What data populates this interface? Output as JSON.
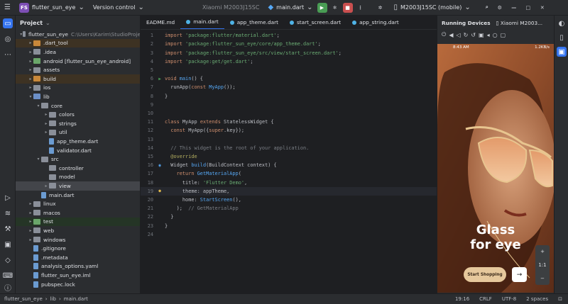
{
  "titlebar": {
    "project_chip": "FS",
    "project_name": "flutter_sun_eye",
    "vcs": "Version control",
    "device_selector": "Xiaomi M2003J15SC",
    "run_config": "main.dart",
    "device_menu": "M2003J15SC (mobile)"
  },
  "project_panel": {
    "title": "Project",
    "tree": [
      {
        "label": "flutter_sun_eye",
        "extra": "C:\\Users\\Karim\\StudioProje",
        "indent": 0,
        "arrow": "▾",
        "icon": "folder",
        "hl": ""
      },
      {
        "label": ".dart_tool",
        "extra": "",
        "indent": 1,
        "arrow": "▸",
        "icon": "folder orange",
        "hl": "hl-orange"
      },
      {
        "label": ".idea",
        "extra": "",
        "indent": 1,
        "arrow": "▸",
        "icon": "folder",
        "hl": ""
      },
      {
        "label": "android [flutter_sun_eye_android]",
        "extra": "",
        "indent": 1,
        "arrow": "▸",
        "icon": "folder green",
        "hl": ""
      },
      {
        "label": "assets",
        "extra": "",
        "indent": 1,
        "arrow": "▸",
        "icon": "folder",
        "hl": ""
      },
      {
        "label": "build",
        "extra": "",
        "indent": 1,
        "arrow": "▸",
        "icon": "folder orange",
        "hl": "hl-orange"
      },
      {
        "label": "ios",
        "extra": "",
        "indent": 1,
        "arrow": "▸",
        "icon": "folder",
        "hl": ""
      },
      {
        "label": "lib",
        "extra": "",
        "indent": 1,
        "arrow": "▾",
        "icon": "folder blue",
        "hl": ""
      },
      {
        "label": "core",
        "extra": "",
        "indent": 2,
        "arrow": "▾",
        "icon": "folder",
        "hl": ""
      },
      {
        "label": "colors",
        "extra": "",
        "indent": 3,
        "arrow": "▸",
        "icon": "folder",
        "hl": ""
      },
      {
        "label": "strings",
        "extra": "",
        "indent": 3,
        "arrow": "▸",
        "icon": "folder",
        "hl": ""
      },
      {
        "label": "util",
        "extra": "",
        "indent": 3,
        "arrow": "▸",
        "icon": "folder",
        "hl": ""
      },
      {
        "label": "app_theme.dart",
        "extra": "",
        "indent": 3,
        "arrow": "",
        "icon": "file",
        "hl": ""
      },
      {
        "label": "validator.dart",
        "extra": "",
        "indent": 3,
        "arrow": "",
        "icon": "file",
        "hl": ""
      },
      {
        "label": "src",
        "extra": "",
        "indent": 2,
        "arrow": "▾",
        "icon": "folder",
        "hl": ""
      },
      {
        "label": "controller",
        "extra": "",
        "indent": 3,
        "arrow": "",
        "icon": "folder",
        "hl": ""
      },
      {
        "label": "model",
        "extra": "",
        "indent": 3,
        "arrow": "",
        "icon": "folder",
        "hl": ""
      },
      {
        "label": "view",
        "extra": "",
        "indent": 3,
        "arrow": "▸",
        "icon": "folder",
        "hl": "selected"
      },
      {
        "label": "main.dart",
        "extra": "",
        "indent": 2,
        "arrow": "",
        "icon": "file",
        "hl": ""
      },
      {
        "label": "linux",
        "extra": "",
        "indent": 1,
        "arrow": "▸",
        "icon": "folder",
        "hl": ""
      },
      {
        "label": "macos",
        "extra": "",
        "indent": 1,
        "arrow": "▸",
        "icon": "folder",
        "hl": ""
      },
      {
        "label": "test",
        "extra": "",
        "indent": 1,
        "arrow": "▸",
        "icon": "folder green",
        "hl": "hl-green"
      },
      {
        "label": "web",
        "extra": "",
        "indent": 1,
        "arrow": "▸",
        "icon": "folder",
        "hl": ""
      },
      {
        "label": "windows",
        "extra": "",
        "indent": 1,
        "arrow": "▸",
        "icon": "folder",
        "hl": ""
      },
      {
        "label": ".gitignore",
        "extra": "",
        "indent": 1,
        "arrow": "",
        "icon": "file",
        "hl": ""
      },
      {
        "label": ".metadata",
        "extra": "",
        "indent": 1,
        "arrow": "",
        "icon": "file",
        "hl": ""
      },
      {
        "label": "analysis_options.yaml",
        "extra": "",
        "indent": 1,
        "arrow": "",
        "icon": "file",
        "hl": ""
      },
      {
        "label": "flutter_sun_eye.iml",
        "extra": "",
        "indent": 1,
        "arrow": "",
        "icon": "file",
        "hl": ""
      },
      {
        "label": "pubspec.lock",
        "extra": "",
        "indent": 1,
        "arrow": "",
        "icon": "file",
        "hl": ""
      }
    ]
  },
  "editor": {
    "tabs": [
      "EADME.md",
      "main.dart",
      "app_theme.dart",
      "start_screen.dart",
      "app_string.dart"
    ],
    "active_tab": 1,
    "current_line": 19,
    "lines": [
      [
        [
          "kw",
          "import "
        ],
        [
          "str",
          "'package:flutter/material.dart'"
        ],
        [
          "ctext",
          ";"
        ]
      ],
      [
        [
          "kw",
          "import "
        ],
        [
          "str",
          "'package:flutter_sun_eye/core/app_theme.dart'"
        ],
        [
          "ctext",
          ";"
        ]
      ],
      [
        [
          "kw",
          "import "
        ],
        [
          "str",
          "'package:flutter_sun_eye/src/view/start_screen.dart'"
        ],
        [
          "ctext",
          ";"
        ]
      ],
      [
        [
          "kw",
          "import "
        ],
        [
          "str",
          "'package:get/get.dart'"
        ],
        [
          "ctext",
          ";"
        ]
      ],
      [],
      [
        [
          "kw",
          "void "
        ],
        [
          "fn",
          "main"
        ],
        [
          "ctext",
          "() {"
        ]
      ],
      [
        [
          "ctext",
          "  runApp("
        ],
        [
          "kw",
          "const "
        ],
        [
          "cls",
          "MyApp"
        ],
        [
          "ctext",
          "());"
        ]
      ],
      [
        [
          "ctext",
          "}"
        ]
      ],
      [],
      [],
      [
        [
          "kw",
          "class "
        ],
        [
          "ctext",
          "MyApp "
        ],
        [
          "kw",
          "extends "
        ],
        [
          "ctext",
          "StatelessWidget {"
        ]
      ],
      [
        [
          "ctext",
          "  "
        ],
        [
          "kw",
          "const "
        ],
        [
          "ctext",
          "MyApp({"
        ],
        [
          "kw",
          "super"
        ],
        [
          "ctext",
          ".key});"
        ]
      ],
      [],
      [
        [
          "cmt",
          "  // This widget is the root of your application."
        ]
      ],
      [
        [
          "ann",
          "  @override"
        ]
      ],
      [
        [
          "ctext",
          "  Widget "
        ],
        [
          "fn",
          "build"
        ],
        [
          "ctext",
          "(BuildContext context) {"
        ]
      ],
      [
        [
          "kw",
          "    return "
        ],
        [
          "cls",
          "GetMaterialApp"
        ],
        [
          "ctext",
          "("
        ]
      ],
      [
        [
          "ctext",
          "      title: "
        ],
        [
          "str",
          "'Flutter Demo'"
        ],
        [
          "ctext",
          ","
        ]
      ],
      [
        [
          "ctext",
          "      theme: appTheme,"
        ]
      ],
      [
        [
          "ctext",
          "      home: "
        ],
        [
          "cls",
          "StartScreen"
        ],
        [
          "ctext",
          "(),"
        ]
      ],
      [
        [
          "ctext",
          "    ); "
        ],
        [
          "cmt",
          " // GetMaterialApp"
        ]
      ],
      [
        [
          "ctext",
          "  }"
        ]
      ],
      [
        [
          "ctext",
          "}"
        ]
      ],
      []
    ]
  },
  "running_devices": {
    "title": "Running Devices",
    "device_tab": "Xiaomi M2003...",
    "phone_time": "8:43 AM",
    "phone_status": "1.2KB/s",
    "headline_1": "Glass",
    "headline_2": "for eye",
    "shop_button": "Start Shopping",
    "zoom_plus": "+",
    "zoom_ratio": "1:1",
    "zoom_minus": "−"
  },
  "statusbar": {
    "crumbs": [
      "flutter_sun_eye",
      "lib",
      "main.dart"
    ],
    "position": "19:16",
    "line_sep": "CRLF",
    "encoding": "UTF-8",
    "indent": "2 spaces"
  },
  "colors": {
    "accent": "#3574f0",
    "run": "#499c54",
    "stop": "#c94f4f"
  }
}
